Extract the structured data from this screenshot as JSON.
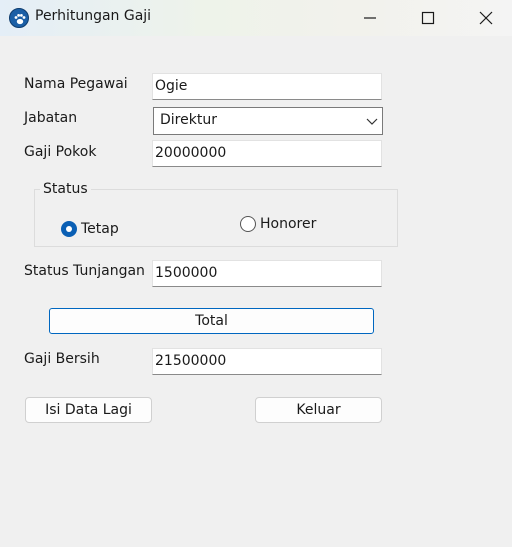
{
  "window": {
    "title": "Perhitungan Gaji",
    "icon": "paw-icon"
  },
  "form": {
    "nama_label": "Nama Pegawai",
    "nama_value": "Ogie",
    "jabatan_label": "Jabatan",
    "jabatan_value": "Direktur",
    "gaji_pokok_label": "Gaji Pokok",
    "gaji_pokok_value": "20000000",
    "status_legend": "Status",
    "status_options": [
      {
        "label": "Tetap",
        "selected": true
      },
      {
        "label": "Honorer",
        "selected": false
      }
    ],
    "tunjangan_label": "Status Tunjangan",
    "tunjangan_value": "1500000",
    "total_button": "Total",
    "gaji_bersih_label": "Gaji Bersih",
    "gaji_bersih_value": "21500000",
    "isi_button": "Isi Data Lagi",
    "keluar_button": "Keluar"
  },
  "colors": {
    "accent": "#0a5fb4",
    "background": "#f0f0f0"
  }
}
